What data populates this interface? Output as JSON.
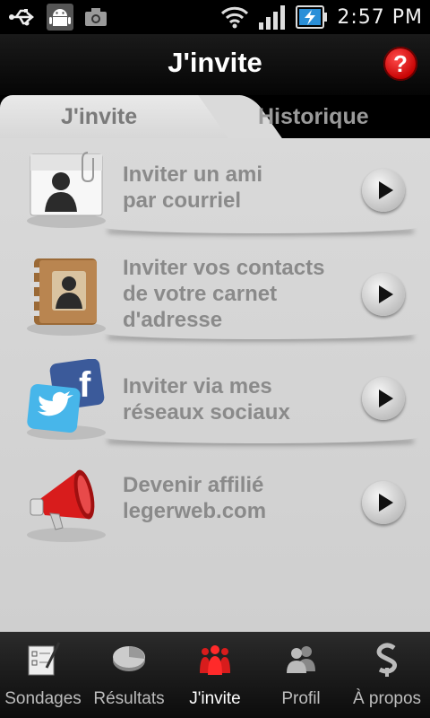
{
  "status": {
    "time": "2:57 PM",
    "icons": [
      "usb-icon",
      "android-debug-icon",
      "camera-icon",
      "wifi-icon",
      "signal-icon",
      "battery-charging-icon"
    ]
  },
  "header": {
    "title": "J'invite",
    "help_label": "?"
  },
  "tabs": [
    {
      "label": "J'invite",
      "active": true
    },
    {
      "label": "Historique",
      "active": false
    }
  ],
  "items": [
    {
      "lines": [
        "Inviter un ami",
        "par courriel"
      ],
      "icon": "contact-card-icon"
    },
    {
      "lines": [
        "Inviter vos contacts",
        "de votre carnet",
        "d'adresse"
      ],
      "icon": "address-book-icon"
    },
    {
      "lines": [
        "Inviter via mes",
        "réseaux sociaux"
      ],
      "icon": "social-networks-icon"
    },
    {
      "lines": [
        "Devenir affilié",
        "legerweb.com"
      ],
      "icon": "megaphone-icon"
    }
  ],
  "nav": [
    {
      "label": "Sondages",
      "icon": "survey-icon",
      "active": false
    },
    {
      "label": "Résultats",
      "icon": "pie-chart-icon",
      "active": false
    },
    {
      "label": "J'invite",
      "icon": "people-icon",
      "active": true
    },
    {
      "label": "Profil",
      "icon": "profile-icon",
      "active": false
    },
    {
      "label": "À propos",
      "icon": "about-logo-icon",
      "active": false
    }
  ],
  "colors": {
    "accent": "#e01010",
    "text_gray": "#8a8a8a"
  }
}
